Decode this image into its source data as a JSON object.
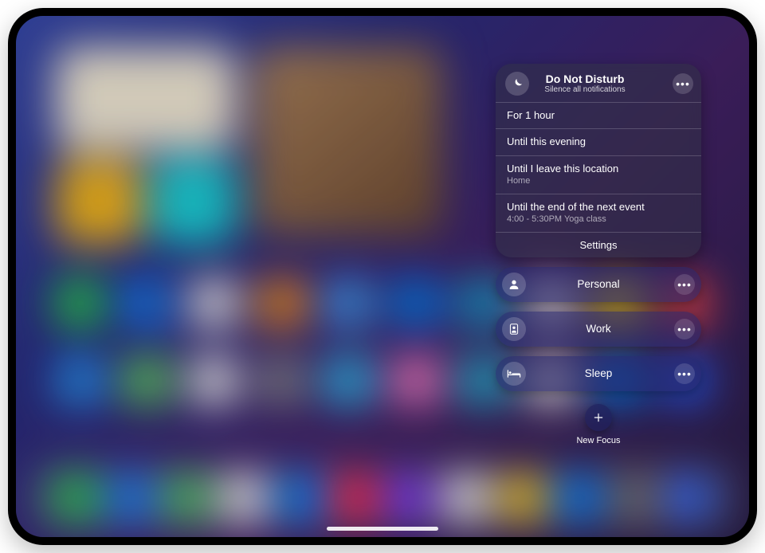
{
  "dnd": {
    "title": "Do Not Disturb",
    "subtitle": "Silence all notifications",
    "options": {
      "hour": "For 1 hour",
      "evening": "Until this evening",
      "location": "Until I leave this location",
      "location_sub": "Home",
      "event": "Until the end of the next event",
      "event_sub": "4:00 - 5:30PM Yoga class"
    },
    "settings": "Settings"
  },
  "focus": {
    "personal": "Personal",
    "work": "Work",
    "sleep": "Sleep"
  },
  "new_focus": "New Focus"
}
